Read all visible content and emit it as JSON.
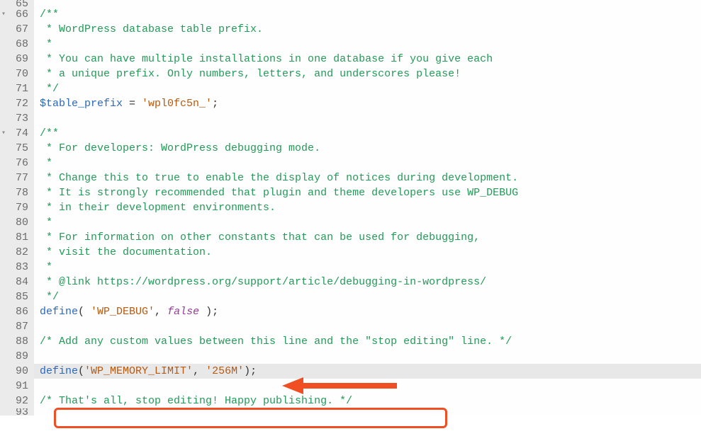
{
  "lines": [
    {
      "num": "65",
      "fold": false,
      "cuttop": true,
      "tokens": []
    },
    {
      "num": "66",
      "fold": true,
      "tokens": [
        {
          "cls": "comment",
          "t": "/**"
        }
      ]
    },
    {
      "num": "67",
      "fold": false,
      "tokens": [
        {
          "cls": "comment",
          "t": " * WordPress database table prefix."
        }
      ]
    },
    {
      "num": "68",
      "fold": false,
      "tokens": [
        {
          "cls": "comment",
          "t": " *"
        }
      ]
    },
    {
      "num": "69",
      "fold": false,
      "tokens": [
        {
          "cls": "comment",
          "t": " * You can have multiple installations in one database if you give each"
        }
      ]
    },
    {
      "num": "70",
      "fold": false,
      "tokens": [
        {
          "cls": "comment",
          "t": " * a unique prefix. Only numbers, letters, and underscores please!"
        }
      ]
    },
    {
      "num": "71",
      "fold": false,
      "tokens": [
        {
          "cls": "comment",
          "t": " */"
        }
      ]
    },
    {
      "num": "72",
      "fold": false,
      "tokens": [
        {
          "cls": "variable",
          "t": "$table_prefix"
        },
        {
          "cls": "operator",
          "t": " = "
        },
        {
          "cls": "string",
          "t": "'wpl0fc5n_'"
        },
        {
          "cls": "operator",
          "t": ";"
        }
      ]
    },
    {
      "num": "73",
      "fold": false,
      "tokens": []
    },
    {
      "num": "74",
      "fold": true,
      "tokens": [
        {
          "cls": "comment",
          "t": "/**"
        }
      ]
    },
    {
      "num": "75",
      "fold": false,
      "tokens": [
        {
          "cls": "comment",
          "t": " * For developers: WordPress debugging mode."
        }
      ]
    },
    {
      "num": "76",
      "fold": false,
      "tokens": [
        {
          "cls": "comment",
          "t": " *"
        }
      ]
    },
    {
      "num": "77",
      "fold": false,
      "tokens": [
        {
          "cls": "comment",
          "t": " * Change this to true to enable the display of notices during development."
        }
      ]
    },
    {
      "num": "78",
      "fold": false,
      "tokens": [
        {
          "cls": "comment",
          "t": " * It is strongly recommended that plugin and theme developers use WP_DEBUG"
        }
      ]
    },
    {
      "num": "79",
      "fold": false,
      "tokens": [
        {
          "cls": "comment",
          "t": " * in their development environments."
        }
      ]
    },
    {
      "num": "80",
      "fold": false,
      "tokens": [
        {
          "cls": "comment",
          "t": " *"
        }
      ]
    },
    {
      "num": "81",
      "fold": false,
      "tokens": [
        {
          "cls": "comment",
          "t": " * For information on other constants that can be used for debugging,"
        }
      ]
    },
    {
      "num": "82",
      "fold": false,
      "tokens": [
        {
          "cls": "comment",
          "t": " * visit the documentation."
        }
      ]
    },
    {
      "num": "83",
      "fold": false,
      "tokens": [
        {
          "cls": "comment",
          "t": " *"
        }
      ]
    },
    {
      "num": "84",
      "fold": false,
      "tokens": [
        {
          "cls": "comment",
          "t": " * @link https://wordpress.org/support/article/debugging-in-wordpress/"
        }
      ]
    },
    {
      "num": "85",
      "fold": false,
      "tokens": [
        {
          "cls": "comment",
          "t": " */"
        }
      ]
    },
    {
      "num": "86",
      "fold": false,
      "tokens": [
        {
          "cls": "fn",
          "t": "define"
        },
        {
          "cls": "operator",
          "t": "( "
        },
        {
          "cls": "string",
          "t": "'WP_DEBUG'"
        },
        {
          "cls": "operator",
          "t": ", "
        },
        {
          "cls": "kw-false",
          "t": "false"
        },
        {
          "cls": "operator",
          "t": " );"
        }
      ]
    },
    {
      "num": "87",
      "fold": false,
      "tokens": []
    },
    {
      "num": "88",
      "fold": false,
      "tokens": [
        {
          "cls": "comment",
          "t": "/* Add any custom values between this line and the \"stop editing\" line. */"
        }
      ]
    },
    {
      "num": "89",
      "fold": false,
      "tokens": []
    },
    {
      "num": "90",
      "fold": false,
      "highlight": true,
      "tokens": [
        {
          "cls": "fn",
          "t": "define"
        },
        {
          "cls": "operator",
          "t": "("
        },
        {
          "cls": "string",
          "t": "'WP_MEMORY_LIMIT'"
        },
        {
          "cls": "operator",
          "t": ", "
        },
        {
          "cls": "string",
          "t": "'256M'"
        },
        {
          "cls": "operator",
          "t": ");"
        }
      ]
    },
    {
      "num": "91",
      "fold": false,
      "tokens": []
    },
    {
      "num": "92",
      "fold": false,
      "tokens": [
        {
          "cls": "comment",
          "t": "/* That's all, stop editing! Happy publishing. */"
        }
      ]
    },
    {
      "num": "93",
      "fold": false,
      "cutbottom": true,
      "tokens": []
    }
  ],
  "annotations": {
    "arrow_color": "#f04e23",
    "box_color": "#f04e23"
  }
}
